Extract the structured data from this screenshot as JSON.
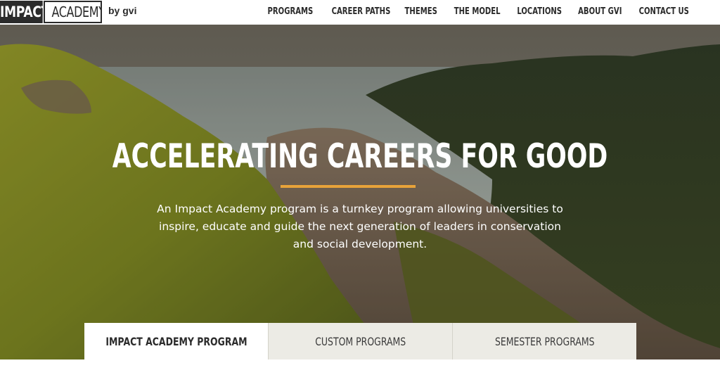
{
  "header": {
    "logo": {
      "impact": "IMPACT",
      "academy": "ACADEMY",
      "by": "by gvi"
    },
    "nav": [
      {
        "label": "PROGRAMS"
      },
      {
        "label": "CAREER PATHS"
      },
      {
        "label": "THEMES"
      },
      {
        "label": "THE MODEL"
      },
      {
        "label": "LOCATIONS"
      },
      {
        "label": "ABOUT GVI"
      },
      {
        "label": "CONTACT US"
      }
    ]
  },
  "hero": {
    "title": "ACCELERATING CAREERS FOR GOOD",
    "description": "An Impact Academy program is a turnkey program allowing universities to inspire, educate and guide the next generation of leaders in conservation and social development.",
    "accent_color": "#e8a33a"
  },
  "tabs": [
    {
      "label": "IMPACT ACADEMY PROGRAM",
      "active": true
    },
    {
      "label": "CUSTOM PROGRAMS",
      "active": false
    },
    {
      "label": "SEMESTER PROGRAMS",
      "active": false
    }
  ]
}
